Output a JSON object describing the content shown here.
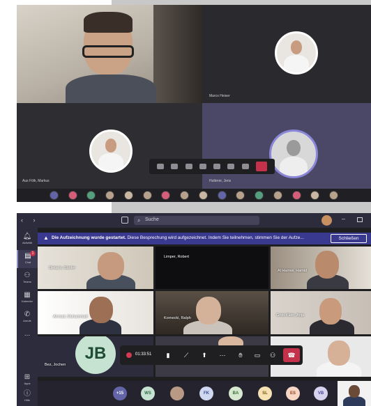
{
  "top_call": {
    "participants": [
      {
        "name": "Marco Heiser"
      },
      {
        "name": "Aus Fölk, Markus"
      },
      {
        "name": "Hutterer, Jens"
      }
    ]
  },
  "window": {
    "nav_arrows": "‹ ›",
    "search_placeholder": "Suche",
    "minimize": "–"
  },
  "rail": {
    "items": [
      {
        "icon": "bell",
        "label": "Aktivität"
      },
      {
        "icon": "chat",
        "label": "Chat",
        "badge": "1"
      },
      {
        "icon": "teams",
        "label": "Teams"
      },
      {
        "icon": "calendar",
        "label": "Kalender"
      },
      {
        "icon": "phone",
        "label": "Anrufe"
      },
      {
        "icon": "more",
        "label": "..."
      },
      {
        "icon": "apps",
        "label": "Apps"
      },
      {
        "icon": "help",
        "label": "Hilfe"
      }
    ]
  },
  "banner": {
    "bold_text": "Die Aufzeichnung wurde gestartet.",
    "text": "Diese Besprechung wird aufgezeichnet. Indem Sie teilnehmen, stimmen Sie der Aufze...",
    "close_label": "Schließen"
  },
  "grid": {
    "tiles": [
      {
        "name": "Dietsch, Günter"
      },
      {
        "name": "Limper, Robert"
      },
      {
        "name": "Al Hamwi, Hamid"
      },
      {
        "name": "Ahmad, Muhammad"
      },
      {
        "name": "Kornecki, Ralph"
      },
      {
        "name": "Grob-Klein, Anja"
      },
      {
        "name": "Bez, Jochen",
        "initials": "JB"
      },
      {
        "name": ""
      },
      {
        "name": ""
      }
    ]
  },
  "call": {
    "timer": "01:33:51"
  },
  "bottom_strip": {
    "avatars": [
      {
        "initials": "+15",
        "color": "#6264a7",
        "text_color": "#ffffff"
      },
      {
        "initials": "WS",
        "color": "#c6e3d1",
        "text_color": "#2f6b45"
      },
      {
        "initials": "",
        "color": "#b89a84",
        "text_color": "#ffffff"
      },
      {
        "initials": "FK",
        "color": "#cfd8f0",
        "text_color": "#3a4f8a"
      },
      {
        "initials": "BA",
        "color": "#d6e9d0",
        "text_color": "#3f6d34"
      },
      {
        "initials": "SL",
        "color": "#f6e2b3",
        "text_color": "#7a5a10"
      },
      {
        "initials": "ES",
        "color": "#f7d6c4",
        "text_color": "#8a4320"
      },
      {
        "initials": "VB",
        "color": "#d7d3ef",
        "text_color": "#4b4596"
      }
    ]
  },
  "colors": {
    "teams_purple": "#6264a7",
    "hangup_red": "#c4314b",
    "banner_blue": "#3a3990"
  }
}
